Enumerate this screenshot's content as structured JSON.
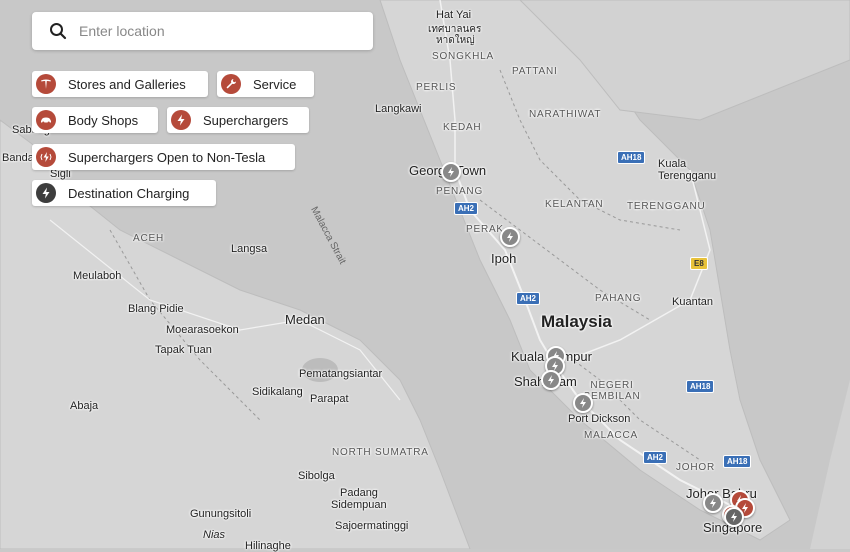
{
  "search": {
    "placeholder": "Enter location"
  },
  "filters": [
    {
      "label": "Stores and Galleries",
      "icon": "tesla-logo-icon",
      "color": "#b54a3a"
    },
    {
      "label": "Service",
      "icon": "wrench-icon",
      "color": "#b54a3a"
    },
    {
      "label": "Body Shops",
      "icon": "car-icon",
      "color": "#b54a3a"
    },
    {
      "label": "Superchargers",
      "icon": "lightning-icon",
      "color": "#b54a3a"
    },
    {
      "label": "Superchargers Open to Non-Tesla",
      "icon": "lightning-plug-icon",
      "color": "#b54a3a"
    },
    {
      "label": "Destination Charging",
      "icon": "lightning-icon",
      "color": "#3d3d3d"
    }
  ],
  "map": {
    "countries": [
      "Malaysia"
    ],
    "cities": [
      "George Town",
      "Ipoh",
      "Medan",
      "Kuala Lumpur",
      "Shah Alam",
      "Port Dickson",
      "Johor Bahru",
      "Singapore",
      "Kuantan",
      "Kuala Terengganu",
      "Hat Yai"
    ],
    "hat_yai_thai": "หาดใหญ่",
    "thai_line": "เทศบาลนคร",
    "regions": [
      "SONGKHLA",
      "PATTANI",
      "PERLIS",
      "NARATHIWAT",
      "KEDAH",
      "KELANTAN",
      "TERENGGANU",
      "PENANG",
      "PERAK",
      "PAHANG",
      "NEGERI SEMBILAN",
      "MALACCA",
      "JOHOR",
      "ACEH",
      "NORTH SUMATRA"
    ],
    "towns": [
      "Langkawi",
      "Langsa",
      "Meulaboh",
      "Blang Pidie",
      "Moearasoekon",
      "Tapak Tuan",
      "Pematangsiantar",
      "Sidikalang",
      "Parapat",
      "Abaja",
      "Sibolga",
      "Padang",
      "Sidempuan",
      "Sajoermatinggi",
      "Gunungsitoli",
      "Nias",
      "Hilinaghe",
      "Sabang",
      "Banda",
      "Sigli"
    ],
    "sea": "Malacca Strait",
    "highways": [
      "AH18",
      "AH2",
      "E8"
    ],
    "accent_red": "#b54a3a",
    "marker_grey": "#888888"
  }
}
